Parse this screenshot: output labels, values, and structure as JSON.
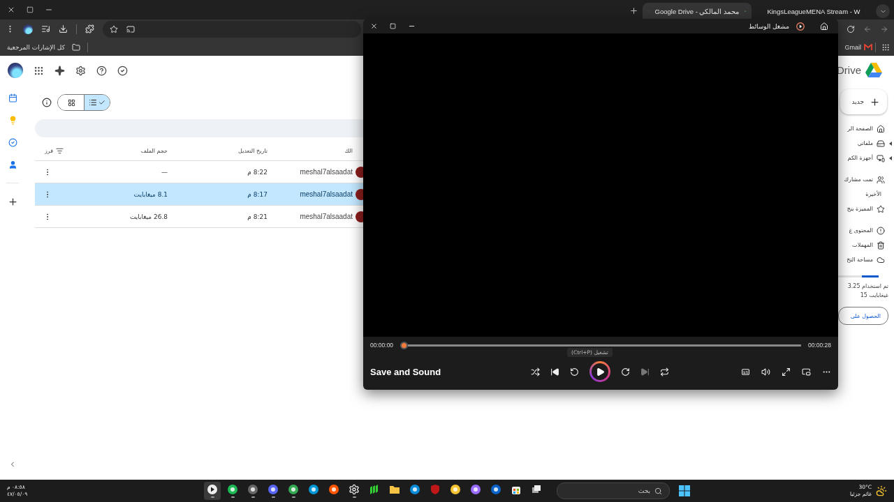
{
  "tabs": [
    {
      "title": "KingsLeagueMENA Stream - W",
      "selected": false,
      "kind": "k"
    },
    {
      "title": "محمد المالكي - Google Drive",
      "selected": true,
      "kind": "drive"
    }
  ],
  "bookmarks": {
    "left": "كل الإشارات المرجعية",
    "right": "Gmail"
  },
  "drive": {
    "logo": "Drive",
    "new_button": "جديد",
    "view_toggle": [
      {
        "kind": "grid",
        "selected": false
      },
      {
        "kind": "list",
        "selected": true
      }
    ],
    "table": {
      "columns": [
        "الك",
        "تاريخ التعديل",
        "حجم الملف",
        "فرز"
      ],
      "rows": [
        {
          "size": "—",
          "modified": "8:22 م",
          "owner": "meshal7alsaadat",
          "selected": false
        },
        {
          "size": "8.1 ميغابايت",
          "modified": "8:17 م",
          "owner": "meshal7alsaadat",
          "selected": true
        },
        {
          "size": "26.8 ميغابايت",
          "modified": "8:21 م",
          "owner": "meshal7alsaadat",
          "selected": false
        }
      ]
    },
    "nav_groups": [
      [
        {
          "kind": "home",
          "label": "الصفحة الر",
          "expandable": false
        },
        {
          "kind": "mydrive",
          "label": "ملفاتي",
          "expandable": true
        },
        {
          "kind": "computers",
          "label": "أجهزة الكم",
          "expandable": true
        }
      ],
      [
        {
          "kind": "shared",
          "label": "تمت مشارك",
          "expandable": false
        },
        {
          "kind": "recent",
          "label": "الأخيرة",
          "expandable": false
        },
        {
          "kind": "starred",
          "label": "المميزة بنج",
          "expandable": false
        }
      ],
      [
        {
          "kind": "spam",
          "label": "المحتوى غ",
          "expandable": false
        },
        {
          "kind": "trash",
          "label": "المهملات",
          "expandable": false
        },
        {
          "kind": "storage",
          "label": "مساحة التخ",
          "expandable": false
        }
      ]
    ],
    "storage": {
      "level": 0.42,
      "used": "تم استخدام 3.25",
      "total": "15 غيغابايت",
      "button": "الحصول على"
    }
  },
  "player": {
    "title": "مشغل الوسائط",
    "elapsed": "00:00:00",
    "duration": "00:00:28",
    "level": 0,
    "tooltip": "تشغيل (Ctrl+P)",
    "track": "Save and Sound",
    "next_disabled": true
  },
  "taskbar": {
    "time": "٠٨:٥٨ م",
    "date": "٤٧/٠٥/٠٩",
    "search_placeholder": "بحث",
    "temperature": "30°C",
    "weather": "غائم جزئيا",
    "apps": [
      {
        "kind": "media",
        "selected": true,
        "running": true
      },
      {
        "kind": "spotify",
        "selected": false,
        "running": true
      },
      {
        "kind": "steam",
        "selected": false,
        "running": true
      },
      {
        "kind": "discord",
        "selected": false,
        "running": true
      },
      {
        "kind": "chrome",
        "selected": false,
        "running": true
      },
      {
        "kind": "hp",
        "selected": false,
        "running": false
      },
      {
        "kind": "soundcloud",
        "selected": false,
        "running": false
      },
      {
        "kind": "gear",
        "selected": false,
        "running": true
      },
      {
        "kind": "bars",
        "selected": false,
        "running": false
      },
      {
        "kind": "folder",
        "selected": false,
        "running": false
      },
      {
        "kind": "edge",
        "selected": false,
        "running": false
      },
      {
        "kind": "shield",
        "selected": false,
        "running": false
      },
      {
        "kind": "help",
        "selected": false,
        "running": false
      },
      {
        "kind": "copilot",
        "selected": false,
        "running": false
      },
      {
        "kind": "mail",
        "selected": false,
        "running": false
      },
      {
        "kind": "store",
        "selected": false,
        "running": false
      },
      {
        "kind": "windows",
        "selected": false,
        "running": false
      }
    ]
  }
}
